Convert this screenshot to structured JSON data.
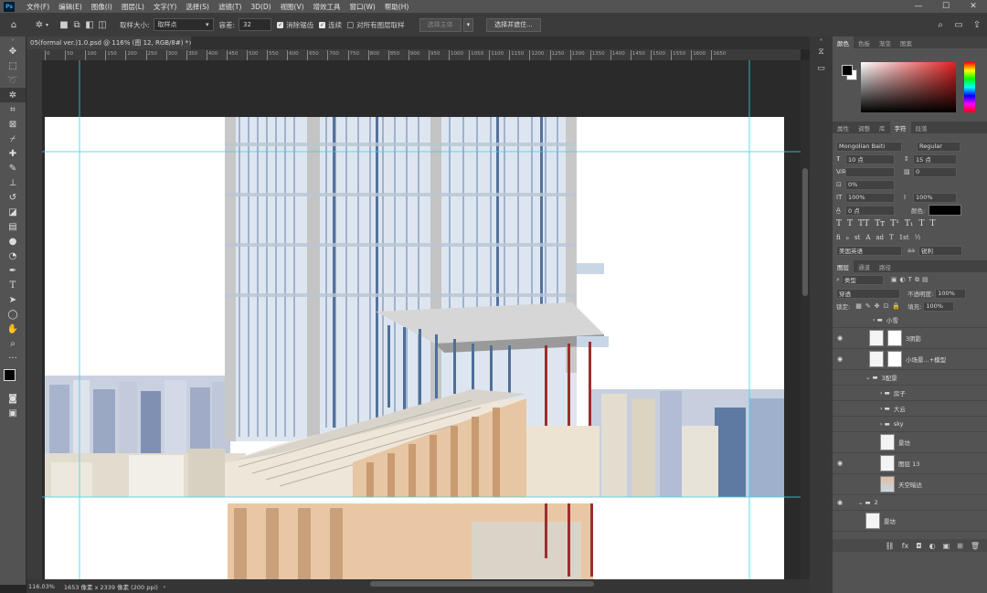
{
  "app": {
    "logo": "Ps"
  },
  "menu": [
    "文件(F)",
    "编辑(E)",
    "图像(I)",
    "图层(L)",
    "文字(Y)",
    "选择(S)",
    "滤镜(T)",
    "3D(D)",
    "视图(V)",
    "增效工具",
    "窗口(W)",
    "帮助(H)"
  ],
  "window_controls": [
    "—",
    "☐",
    "✕"
  ],
  "options": {
    "sample_size_label": "取样大小:",
    "sample_size_value": "取样点",
    "tolerance_label": "容差:",
    "tolerance_value": "32",
    "antialias": "消除锯齿",
    "contiguous": "连续",
    "all_layers": "对所有图层取样",
    "select_subject": "选择主体",
    "select_mask": "选择并遮住..."
  },
  "document": {
    "tab_title": "05(formal ver.)1.0.psd @ 116% (图 12, RGB/8#) *",
    "close": "×"
  },
  "ruler": {
    "ticks": [
      "0",
      "50",
      "100",
      "150",
      "200",
      "250",
      "300",
      "350",
      "400",
      "450",
      "500",
      "550",
      "600",
      "650",
      "700",
      "750",
      "800",
      "850",
      "900",
      "950",
      "1000",
      "1050",
      "1100",
      "1150",
      "1200",
      "1250",
      "1300",
      "1350",
      "1400",
      "1450",
      "1500",
      "1550",
      "1600",
      "1650"
    ]
  },
  "status": {
    "zoom": "116.03%",
    "doc_size": "1653 像素 x 2339 像素 (200 ppi)",
    "arrow": "›"
  },
  "color_panel": {
    "tabs": [
      "颜色",
      "色板",
      "渐变",
      "图案"
    ]
  },
  "char_panel": {
    "tabs": [
      "属性",
      "调整",
      "库",
      "字符",
      "段落"
    ],
    "font_family": "Mongolian Baiti",
    "font_style": "Regular",
    "size": "10 点",
    "leading": "15 点",
    "tracking": "0",
    "kerning_pct": "0%",
    "vscale": "100%",
    "hscale": "100%",
    "baseline": "0 点",
    "color_label": "颜色:",
    "glyphs": [
      "T",
      "T",
      "TT",
      "Tт",
      "T¹",
      "T₁",
      "T",
      "T"
    ],
    "glyphs2": [
      "fi",
      "ℴ",
      "st",
      "A",
      "ad",
      "T",
      "1st",
      "½"
    ],
    "language": "美国英语",
    "aa": "aa",
    "aa_method": "锐利"
  },
  "layers_panel": {
    "tabs": [
      "图层",
      "通道",
      "路径"
    ],
    "kind": "类型",
    "blend": "穿透",
    "opacity_label": "不透明度:",
    "opacity": "100%",
    "lock_label": "锁定:",
    "fill_label": "填充:",
    "fill": "100%",
    "layers": [
      {
        "name": "小雪",
        "type": "group",
        "visible": false
      },
      {
        "name": "3阴影",
        "type": "layer-mask",
        "visible": true
      },
      {
        "name": "小场景...+模型",
        "type": "layer-mask",
        "visible": true
      },
      {
        "name": "3配景",
        "type": "group",
        "visible": false
      },
      {
        "name": "房子",
        "type": "subgroup",
        "visible": false
      },
      {
        "name": "大云",
        "type": "subgroup",
        "visible": false
      },
      {
        "name": "sky",
        "type": "subgroup",
        "visible": false
      },
      {
        "name": "景坊",
        "type": "layer",
        "visible": false
      },
      {
        "name": "图层 13",
        "type": "layer",
        "visible": true
      },
      {
        "name": "天空暗达",
        "type": "layer",
        "visible": false
      },
      {
        "name": "2",
        "type": "group",
        "visible": true
      },
      {
        "name": "景坊",
        "type": "layer",
        "visible": false
      }
    ],
    "footer_icons": [
      "⛓",
      "fx",
      "◘",
      "◐",
      "▣",
      "⊞",
      "🗑"
    ]
  }
}
